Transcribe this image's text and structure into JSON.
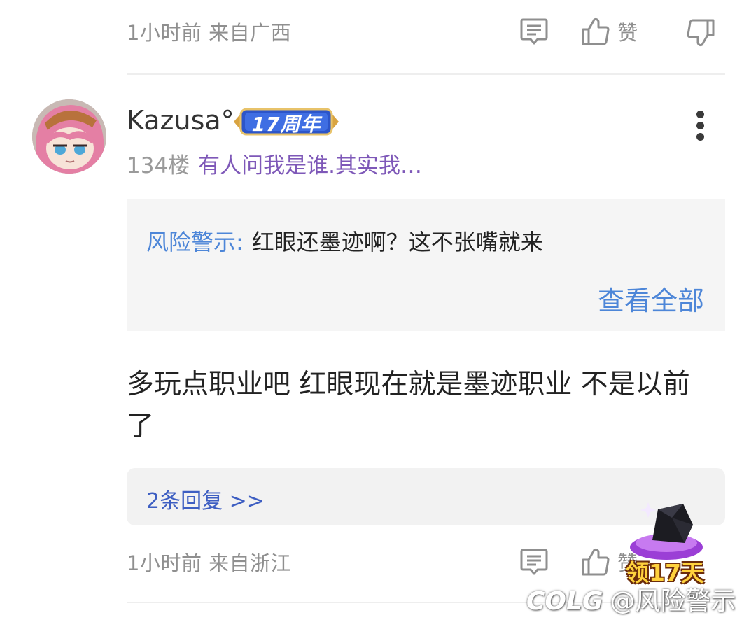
{
  "prev_comment": {
    "meta": "1小时前 来自广西",
    "like_label": "赞"
  },
  "comment": {
    "username": "Kazusa°",
    "badge": "17周年",
    "floor": "134楼",
    "tagline": "有人问我是谁.其实我…",
    "quote": {
      "author": "风险警示:",
      "text": "红眼还墨迹啊？这不张嘴就来",
      "view_all": "查看全部"
    },
    "body_line1": "多玩点职业吧 红眼现在就是墨迹职业  不是以前",
    "body_line2": "了",
    "replies": "2条回复 >>",
    "meta": "1小时前 来自浙江",
    "like_label": "赞"
  },
  "promo": {
    "text": "领17天"
  },
  "watermark": {
    "logo": "COLG",
    "text": "@风险警示"
  },
  "colors": {
    "accent_blue": "#4d86d8",
    "reply_blue": "#3d5ec2",
    "tagline_purple": "#7e58b8",
    "meta_gray": "#8f8f8f"
  },
  "icons": [
    "comment-icon",
    "thumbs-up-icon",
    "thumbs-down-icon",
    "more-vertical-icon"
  ]
}
